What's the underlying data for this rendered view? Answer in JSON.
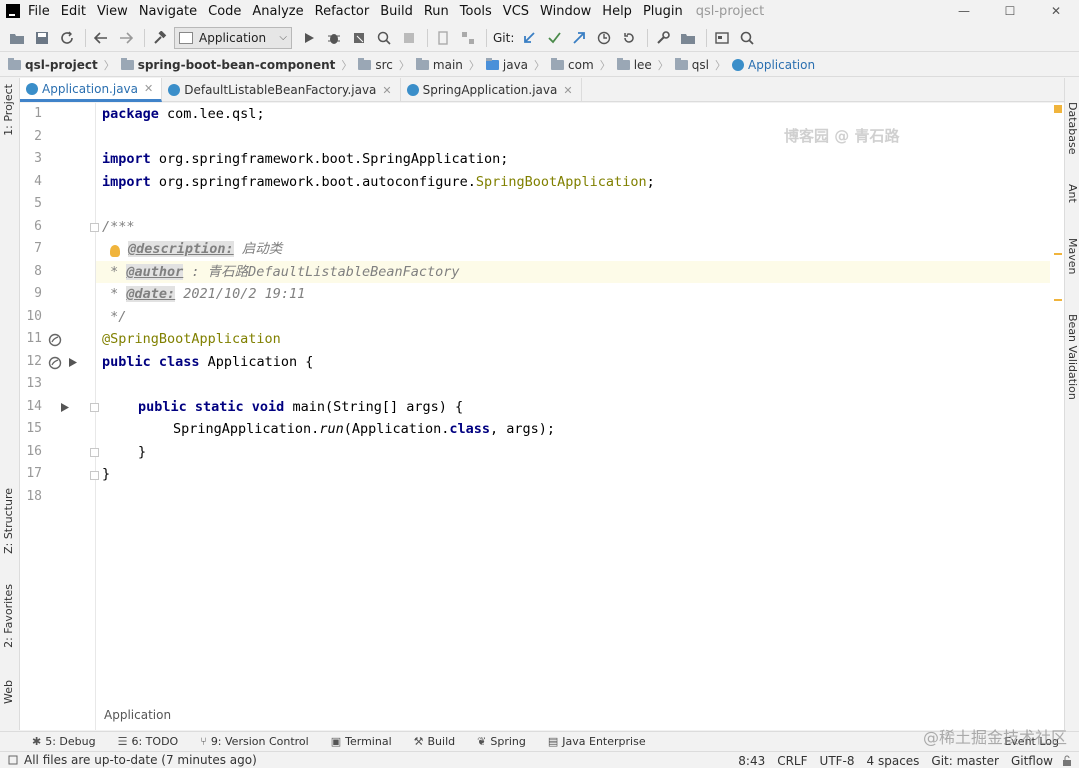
{
  "menu": {
    "items": [
      "File",
      "Edit",
      "View",
      "Navigate",
      "Code",
      "Analyze",
      "Refactor",
      "Build",
      "Run",
      "Tools",
      "VCS",
      "Window",
      "Help",
      "Plugin"
    ],
    "window_title": "qsl-project"
  },
  "window_controls": {
    "minimize": "—",
    "maximize": "☐",
    "close": "✕"
  },
  "toolbar": {
    "run_config": "Application",
    "git_label": "Git:"
  },
  "breadcrumb": [
    "qsl-project",
    "spring-boot-bean-component",
    "src",
    "main",
    "java",
    "com",
    "lee",
    "qsl",
    "Application"
  ],
  "left_tool_tabs": [
    "1: Project",
    "Z: Structure",
    "2: Favorites",
    "Web"
  ],
  "right_tool_tabs": [
    "Database",
    "Ant",
    "Maven",
    "Bean Validation"
  ],
  "editor_tabs": [
    {
      "label": "Application.java",
      "active": true
    },
    {
      "label": "DefaultListableBeanFactory.java",
      "active": false
    },
    {
      "label": "SpringApplication.java",
      "active": false
    }
  ],
  "code": {
    "line_numbers": [
      "1",
      "2",
      "3",
      "4",
      "5",
      "6",
      "7",
      "8",
      "9",
      "10",
      "11",
      "12",
      "13",
      "14",
      "15",
      "16",
      "17",
      "18"
    ],
    "l1_kw": "package",
    "l1_rest": " com.lee.qsl;",
    "l3_kw": "import",
    "l3_rest": " org.springframework.boot.SpringApplication;",
    "l4_kw": "import",
    "l4_rest": " org.springframework.boot.autoconfigure.",
    "l4_ann": "SpringBootApplication",
    "l4_end": ";",
    "l6": "/***",
    "l7_tag": "@description:",
    "l7_text": " 启动类",
    "l8_star": " * ",
    "l8_tag": "@author",
    "l8_text": " : 青石路DefaultListableBeanFactory",
    "l9_star": " * ",
    "l9_tag": "@date:",
    "l9_text": " 2021/10/2 19:11",
    "l10": " */",
    "l11": "@SpringBootApplication",
    "l12_kw": "public class",
    "l12_rest": " Application {",
    "l14_kw": "public static void",
    "l14_rest": " main(String[] args) {",
    "l15_a": "SpringApplication.",
    "l15_run": "run",
    "l15_b": "(Application.",
    "l15_kw": "class",
    "l15_c": ", args);",
    "l16": "}",
    "l17": "}"
  },
  "watermark": "博客园 @ 青石路",
  "editor_crumb": "Application",
  "tool_windows": [
    {
      "icon": "debug-icon",
      "label": "5: Debug"
    },
    {
      "icon": "todo-icon",
      "label": "6: TODO"
    },
    {
      "icon": "version-control-icon",
      "label": "9: Version Control"
    },
    {
      "icon": "terminal-icon",
      "label": "Terminal"
    },
    {
      "icon": "build-icon",
      "label": "Build"
    },
    {
      "icon": "spring-icon",
      "label": "Spring"
    },
    {
      "icon": "java-enterprise-icon",
      "label": "Java Enterprise"
    }
  ],
  "event_log": "Event Log",
  "site_watermark": "@稀土掘金技术社区",
  "status": {
    "message": "All files are up-to-date (7 minutes ago)",
    "position": "8:43",
    "line_sep": "CRLF",
    "encoding": "UTF-8",
    "indent": "4 spaces",
    "git_branch": "Git: master",
    "gitflow": "Gitflow"
  },
  "colors": {
    "keyword": "#000080",
    "annotation": "#808000",
    "comment": "#808080",
    "accent": "#4083c9"
  }
}
